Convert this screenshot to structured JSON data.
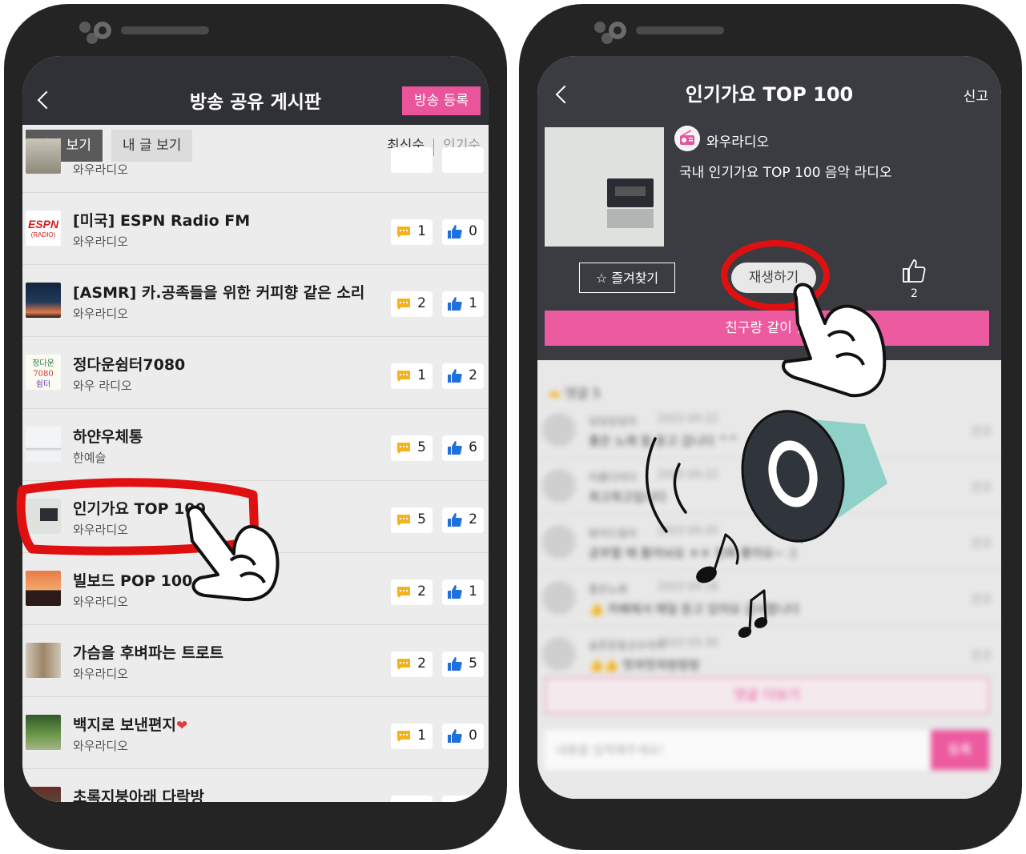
{
  "colors": {
    "accent_pink": "#e9549a",
    "header_dark": "#2f3136",
    "panel_dark": "#3a3c42",
    "highlight_red": "#e01010",
    "like_blue": "#1f6fdc",
    "comment_yellow": "#f5b21f"
  },
  "left_screen": {
    "header": {
      "back_icon": "chevron-left-icon",
      "title": "방송 공유 게시판",
      "register_button": "방송 등록"
    },
    "filters": {
      "tabs": [
        "전체 보기",
        "내 글 보기"
      ],
      "selected_tab": "전체 보기",
      "sort_options": [
        "최신순",
        "인기순"
      ],
      "selected_sort": "최신순"
    },
    "partial_top_author": "와우라디오",
    "posts": [
      {
        "name": "[미국] ESPN Radio FM",
        "author": "와우라디오",
        "comments": "1",
        "likes": "0"
      },
      {
        "name": "[ASMR] 카.공족들을 위한 커피향 같은 소리",
        "author": "와우라디오",
        "comments": "2",
        "likes": "1"
      },
      {
        "name": "정다운쉼터7080",
        "author": "와우 라디오",
        "comments": "1",
        "likes": "2"
      },
      {
        "name": "하얀우체통",
        "author": "한예슬",
        "comments": "5",
        "likes": "6"
      },
      {
        "name": "인기가요 TOP 100",
        "author": "와우라디오",
        "comments": "5",
        "likes": "2"
      },
      {
        "name": "빌보드 POP 100",
        "author": "와우라디오",
        "comments": "2",
        "likes": "1"
      },
      {
        "name": "가슴을 후벼파는 트로트",
        "author": "와우라디오",
        "comments": "2",
        "likes": "5"
      },
      {
        "name": "백지로 보낸편지",
        "author": "와우라디오",
        "comments": "1",
        "likes": "0"
      },
      {
        "name": "초록지붕아래 다락방",
        "author": "",
        "comments": "",
        "likes": ""
      }
    ],
    "heart_glyph": "❤",
    "thumb_text_espn": "ESPN",
    "thumb_text_espn_sub": "(RADIO)",
    "thumb_text_7080": [
      "정다운",
      "7080",
      "쉼터"
    ]
  },
  "right_screen": {
    "header": {
      "back_icon": "chevron-left-icon",
      "title": "인기가요 TOP 100",
      "report": "신고"
    },
    "station_name": "와우라디오",
    "description": "국내 인기가요 TOP 100 음악 라디오",
    "favorite_button": "즐겨찾기",
    "play_button": "재생하기",
    "like_count": "2",
    "listen_together_button": "친구랑 같이 듣",
    "comments_heading": "댓글 5",
    "comments": [
      {
        "nick": "딩딩딩딩이",
        "date": "2022-04-22",
        "text": "좋은 노래 잘 듣고 갑니다 ^^",
        "report": "신고"
      },
      {
        "nick": "아름다이다",
        "date": "2022-04-22",
        "text": "최고최고입니다",
        "report": "신고"
      },
      {
        "nick": "방이드림이",
        "date": "2022-04-20",
        "text": "공부할 때 틀어놔요 ㅎㅎ 진짜 좋아요~ :)",
        "report": "신고"
      },
      {
        "nick": "좋은노래",
        "date": "2022-04-18",
        "text": "👍 카페에서 매일 듣고 있어요 감사합니다",
        "report": "신고"
      },
      {
        "nick": "슬픈운동선수아이",
        "date": "2022-03-30",
        "text": "👍👍 멋져멋져방방방",
        "report": "신고"
      }
    ],
    "more_comments_button": "댓글 더보기",
    "comment_placeholder": "내용을 입력해주세요!",
    "submit_button": "등록"
  }
}
